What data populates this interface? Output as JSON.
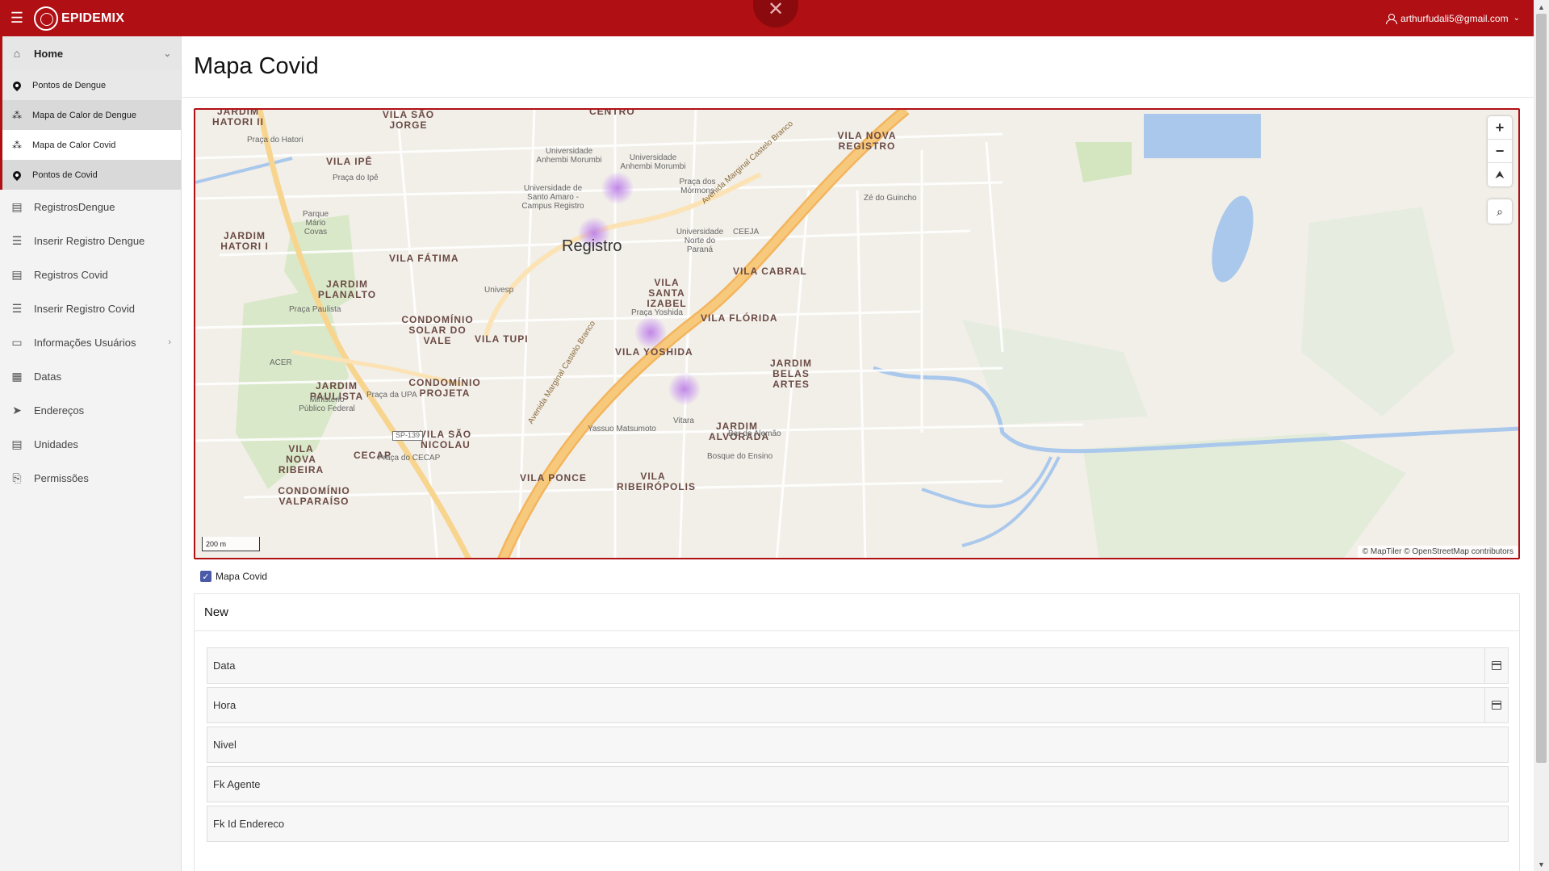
{
  "header": {
    "brand": "EPIDEMIX",
    "close_glyph": "✕",
    "user_email": "arthurfudali5@gmail.com",
    "user_caret": "⌄",
    "colors": {
      "primary": "#b00f14"
    }
  },
  "sidebar": {
    "home_label": "Home",
    "submenu": [
      {
        "label": "Pontos de Dengue",
        "icon": "map-pin-icon"
      },
      {
        "label": "Mapa de Calor de Dengue",
        "icon": "heatmap-icon"
      },
      {
        "label": "Mapa de Calor Covid",
        "icon": "heatmap-icon"
      },
      {
        "label": "Pontos de Covid",
        "icon": "map-pin-icon"
      }
    ],
    "items": [
      {
        "label": "RegistrosDengue",
        "icon": "table-search-icon"
      },
      {
        "label": "Inserir Registro Dengue",
        "icon": "form-icon"
      },
      {
        "label": "Registros Covid",
        "icon": "table-search-icon"
      },
      {
        "label": "Inserir Registro Covid",
        "icon": "form-icon"
      },
      {
        "label": "Informações Usuários",
        "icon": "id-card-icon"
      },
      {
        "label": "Datas",
        "icon": "calendar-icon"
      },
      {
        "label": "Endereços",
        "icon": "navigation-icon"
      },
      {
        "label": "Unidades",
        "icon": "table-icon"
      },
      {
        "label": "Permissões",
        "icon": "clipboard-lock-icon"
      }
    ]
  },
  "main": {
    "title": "Mapa Covid",
    "map": {
      "city": "Registro",
      "neighborhoods": [
        "JARDIM HATORI II",
        "VILA SÃO JORGE",
        "CENTRO",
        "VILA NOVA REGISTRO",
        "VILA IPÊ",
        "JARDIM HATORI I",
        "VILA FÁTIMA",
        "VILA CABRAL",
        "JARDIM PLANALTO",
        "VILA SANTA IZABEL",
        "CONDOMÍNIO SOLAR DO VALE",
        "VILA TUPI",
        "VILA FLÓRIDA",
        "VILA YOSHIDA",
        "JARDIM PAULISTA",
        "CONDOMÍNIO PROJETA",
        "JARDIM BELAS ARTES",
        "JARDIM ALVORADA",
        "VILA SÃO NICOLAU",
        "VILA NOVA RIBEIRA",
        "CECAP",
        "VILA PONCE",
        "VILA RIBEIRÓPOLIS",
        "CONDOMÍNIO VALPARAÍSO"
      ],
      "pois": [
        "Praça do Hatori",
        "Universidade Anhembi Morumbi",
        "Universidade Anhembi Morumbi",
        "Praça dos Mórmons",
        "Praça do Ipê",
        "Universidade de Santo Amaro - Campus Registro",
        "Parque Mário Covas",
        "Universidade Norte do Paraná",
        "CEEJA",
        "Zé do Guincho",
        "Univesp",
        "Praça Paulista",
        "Praça Yoshida",
        "ACER",
        "Ministério Público Federal",
        "Praça da UPA",
        "Yassuo Matsumoto",
        "Vitara",
        "Bar do Alemão",
        "Bosque do Ensino",
        "Praça do CECAP",
        "SP-139"
      ],
      "road_labels": [
        "Avenida Marginal Castelo Branco",
        "Avenida Marginal Castelo Branco"
      ],
      "zoom_in": "+",
      "zoom_out": "−",
      "compass": "⮝",
      "scale": "200 m",
      "attribution": "© MapTiler  © OpenStreetMap contributors",
      "heat_points": 4
    },
    "layer_label": "Mapa Covid",
    "layer_checked": true,
    "form": {
      "heading": "New",
      "fields": [
        {
          "placeholder": "Data",
          "has_calendar": true
        },
        {
          "placeholder": "Hora",
          "has_calendar": true
        },
        {
          "placeholder": "Nivel",
          "has_calendar": false
        },
        {
          "placeholder": "Fk Agente",
          "has_calendar": false
        },
        {
          "placeholder": "Fk Id Endereco",
          "has_calendar": false
        }
      ]
    }
  }
}
